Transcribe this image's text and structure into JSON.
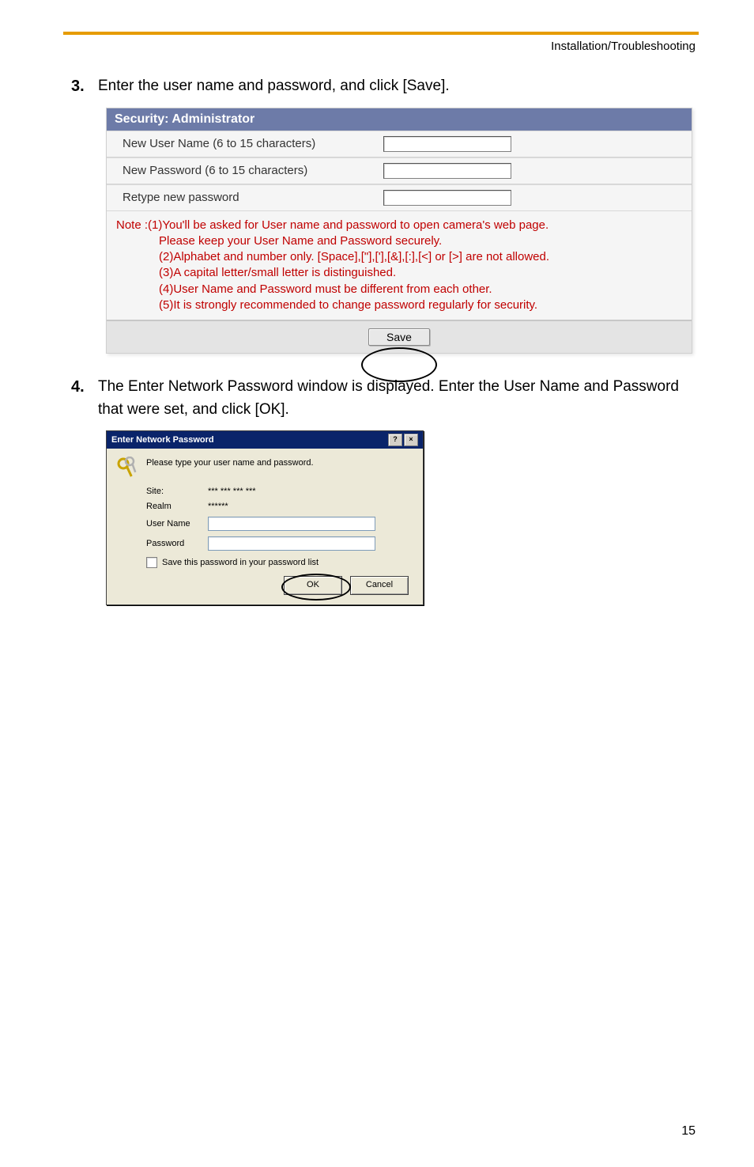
{
  "header": {
    "section": "Installation/Troubleshooting"
  },
  "steps": {
    "s3": {
      "num": "3.",
      "text": "Enter the user name and password, and click [Save]."
    },
    "s4": {
      "num": "4.",
      "text": "The Enter Network Password window is displayed. Enter the User Name and Password that were set, and click [OK]."
    }
  },
  "security_panel": {
    "title": "Security: Administrator",
    "rows": {
      "new_user": "New User Name (6 to 15 characters)",
      "new_pass": "New Password (6 to 15 characters)",
      "retype": "Retype new password"
    },
    "note": {
      "line1": "Note :(1)You'll be asked for User name and password to open camera's web page.",
      "line2": "Please keep your User Name and Password securely.",
      "line3": "(2)Alphabet and number only. [Space],[\"],['],[&],[:],[<] or [>] are not allowed.",
      "line4": "(3)A capital letter/small letter is distinguished.",
      "line5": "(4)User Name and Password must be different from each other.",
      "line6": "(5)It is strongly recommended to change password regularly for security."
    },
    "save_label": "Save"
  },
  "dialog": {
    "title": "Enter Network Password",
    "help_label": "?",
    "close_label": "×",
    "prompt": "Please type your user name and password.",
    "site_label": "Site:",
    "site_value": "*** *** *** ***",
    "realm_label": "Realm",
    "realm_value": "******",
    "username_label": "User Name",
    "password_label": "Password",
    "save_pw_label": "Save this password in your password list",
    "ok_label": "OK",
    "cancel_label": "Cancel"
  },
  "page_number": "15"
}
